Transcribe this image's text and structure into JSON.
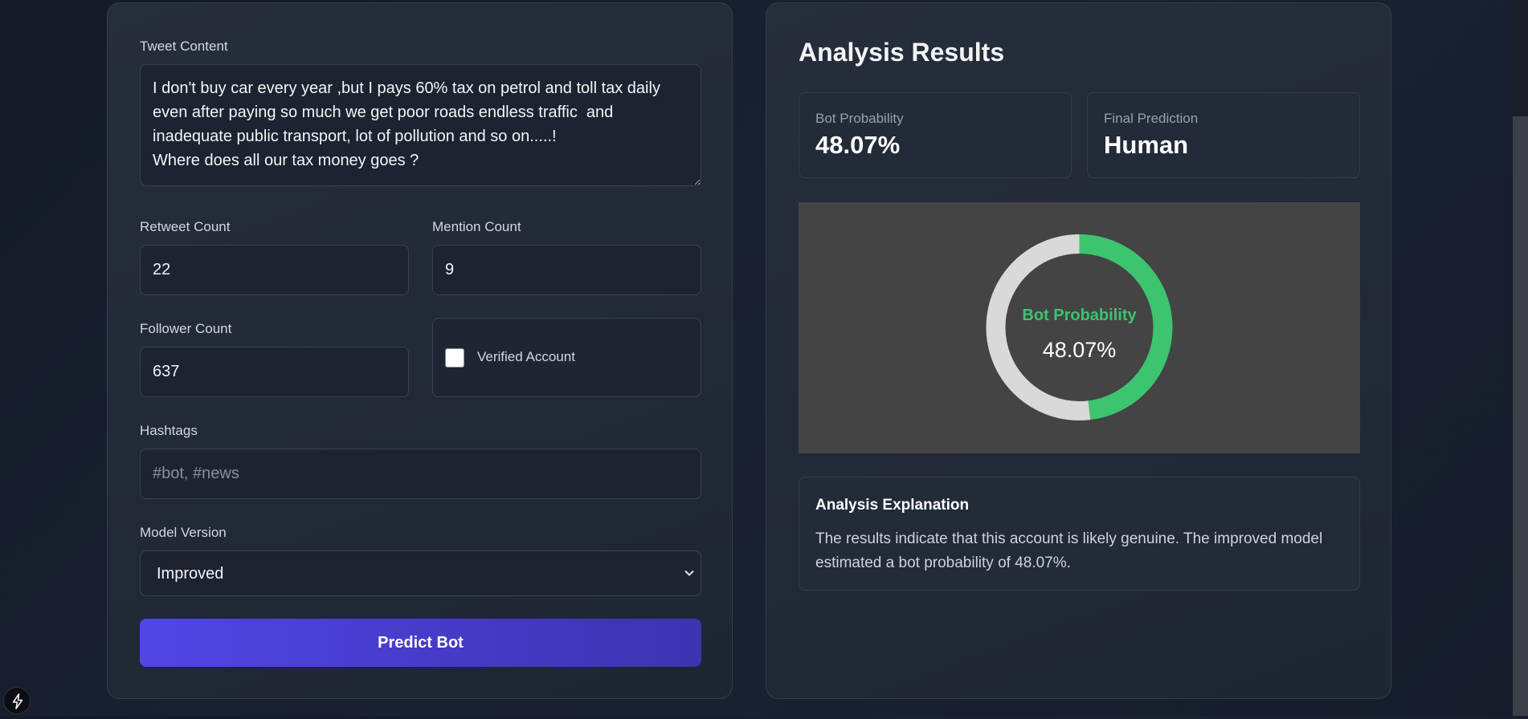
{
  "form": {
    "tweet_label": "Tweet Content",
    "tweet_value": "I don't buy car every year ,but I pays 60% tax on petrol and toll tax daily even after paying so much we get poor roads endless traffic  and inadequate public transport, lot of pollution and so on.....!\nWhere does all our tax money goes ?",
    "retweet_label": "Retweet Count",
    "retweet_value": "22",
    "mention_label": "Mention Count",
    "mention_value": "9",
    "follower_label": "Follower Count",
    "follower_value": "637",
    "verified_label": "Verified Account",
    "verified_checked": false,
    "hashtags_label": "Hashtags",
    "hashtags_value": "",
    "hashtags_placeholder": "#bot, #news",
    "model_label": "Model Version",
    "model_selected": "Improved",
    "predict_label": "Predict Bot"
  },
  "results": {
    "title": "Analysis Results",
    "bot_probability_label": "Bot Probability",
    "bot_probability_value": "48.07%",
    "final_prediction_label": "Final Prediction",
    "final_prediction_value": "Human",
    "explanation_title": "Analysis Explanation",
    "explanation_text": "The results indicate that this account is likely genuine. The improved model estimated a bot probability of 48.07%."
  },
  "chart_data": {
    "type": "pie",
    "title": "Bot Probability",
    "center_value": "48.07%",
    "values": [
      48.07,
      51.93
    ],
    "colors": [
      "#3cc46e",
      "#d9d9d9"
    ],
    "background": "#444444"
  },
  "icons": {
    "corner": "lightning-icon",
    "select_arrow": "chevron-down-icon"
  }
}
